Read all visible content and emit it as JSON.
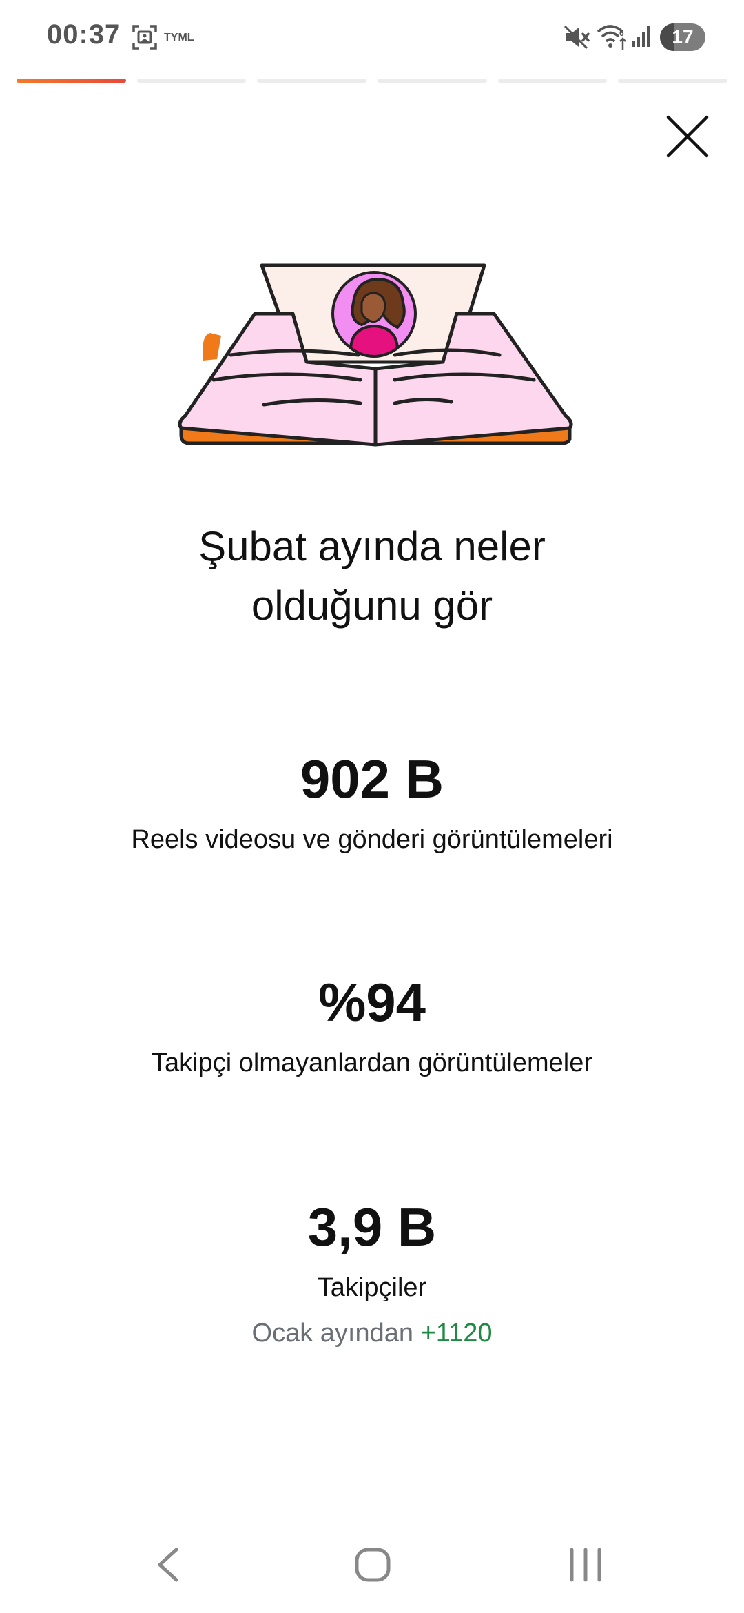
{
  "status_bar": {
    "time": "00:37",
    "carrier": "TYML",
    "battery_level": "17",
    "icons": [
      "screenshot-icon",
      "mute-icon",
      "wifi-icon",
      "signal-icon",
      "battery-icon"
    ]
  },
  "progress": {
    "segments_total": 6,
    "active_segment": 1,
    "active_color": "#f37a2b"
  },
  "header": {
    "close_icon": "close-icon"
  },
  "illustration": {
    "name": "open-book-with-avatar-illustration"
  },
  "main": {
    "title_line1": "Şubat ayında neler",
    "title_line2": "olduğunu gör",
    "stats": [
      {
        "value": "902 B",
        "label": "Reels videosu ve gönderi görüntülemeleri"
      },
      {
        "value": "%94",
        "label": "Takipçi olmayanlardan görüntülemeler"
      },
      {
        "value": "3,9 B",
        "label": "Takipçiler",
        "change_prefix": "Ocak ayından",
        "change_value": "+1120",
        "change_color": "#1f8a43"
      }
    ]
  },
  "nav_bar": {
    "icons": [
      "back-icon",
      "home-icon",
      "recents-icon"
    ]
  }
}
